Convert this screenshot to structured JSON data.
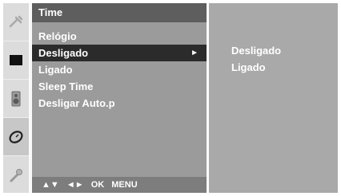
{
  "menu": {
    "title": "Time",
    "items": [
      {
        "label": "Relógio"
      },
      {
        "label": "Desligado",
        "selected": true,
        "arrow": "►"
      },
      {
        "label": "Ligado"
      },
      {
        "label": "Sleep Time"
      },
      {
        "label": "Desligar Auto.p"
      }
    ]
  },
  "submenu": {
    "options": [
      "Desligado",
      "Ligado"
    ]
  },
  "hints": {
    "nav": "▲▼",
    "lr": "◄►",
    "ok": "OK",
    "menu": "MENU"
  },
  "sidebar": {
    "icons": [
      "picture-icon",
      "screen-icon",
      "sound-icon",
      "time-icon",
      "option-icon"
    ],
    "active": "time-icon"
  }
}
